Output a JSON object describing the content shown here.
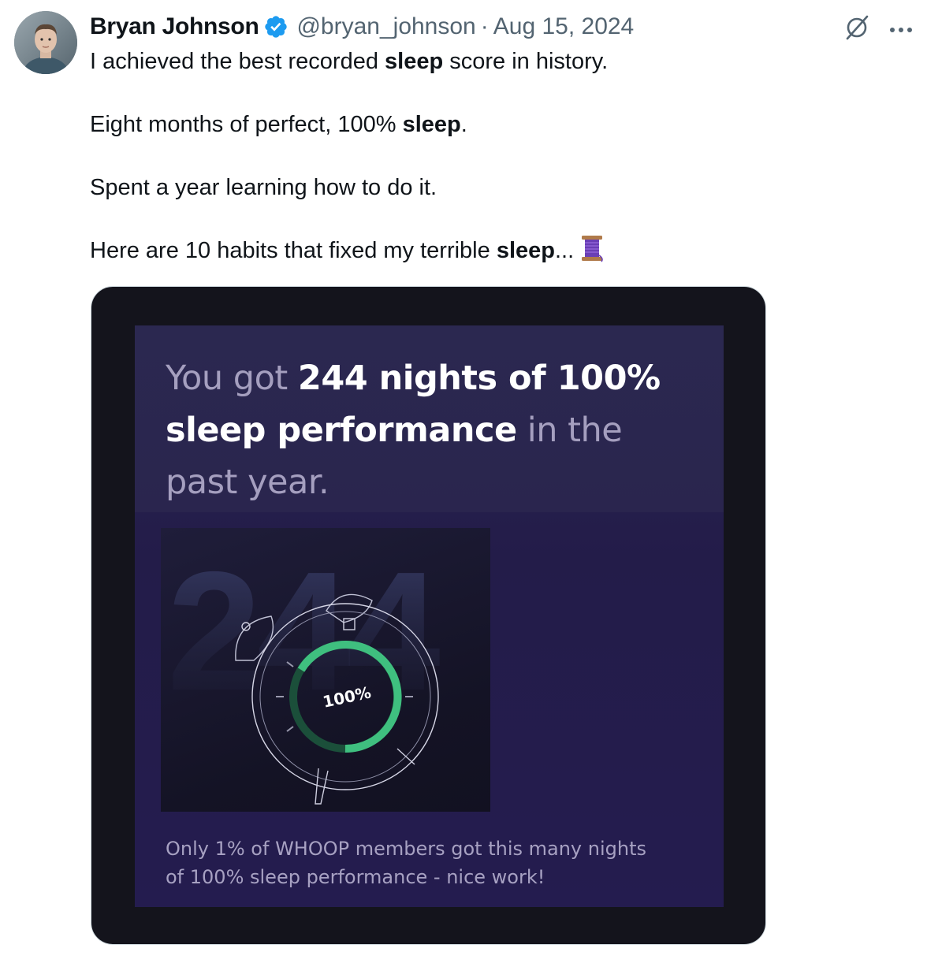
{
  "tweet": {
    "author_name": "Bryan Johnson",
    "handle": "@bryan_johnson",
    "separator": "·",
    "date": "Aug 15, 2024",
    "icons": {
      "avatar": "avatar",
      "verified": "verified-badge-icon",
      "grok": "grok-icon",
      "more": "more-icon",
      "spool": "spool-of-thread-icon"
    },
    "text": {
      "line1_pre": "I achieved the best recorded ",
      "line1_bold": "sleep",
      "line1_post": " score in history.",
      "line2_pre": "Eight months of perfect, 100% ",
      "line2_bold": "sleep",
      "line2_post": ".",
      "line3": "Spent a year learning how to do it.",
      "line4_pre": "Here are 10 habits that fixed my terrible ",
      "line4_bold": "sleep",
      "line4_post": "..."
    }
  },
  "media": {
    "headline": {
      "part1": "You got ",
      "part2": "244 nights of 100%",
      "part3": "sleep performance",
      "part4": " in the",
      "part5": "past year."
    },
    "big_number": "244",
    "gauge_label": "100%",
    "footer_line1": "Only 1% of WHOOP members got this many nights",
    "footer_line2": "of 100% sleep performance - nice work!",
    "colors": {
      "background": "#14141c",
      "card": "#241c4f",
      "gauge_green": "#3fbf7f",
      "accent_blue": "#1d9bf0"
    }
  }
}
